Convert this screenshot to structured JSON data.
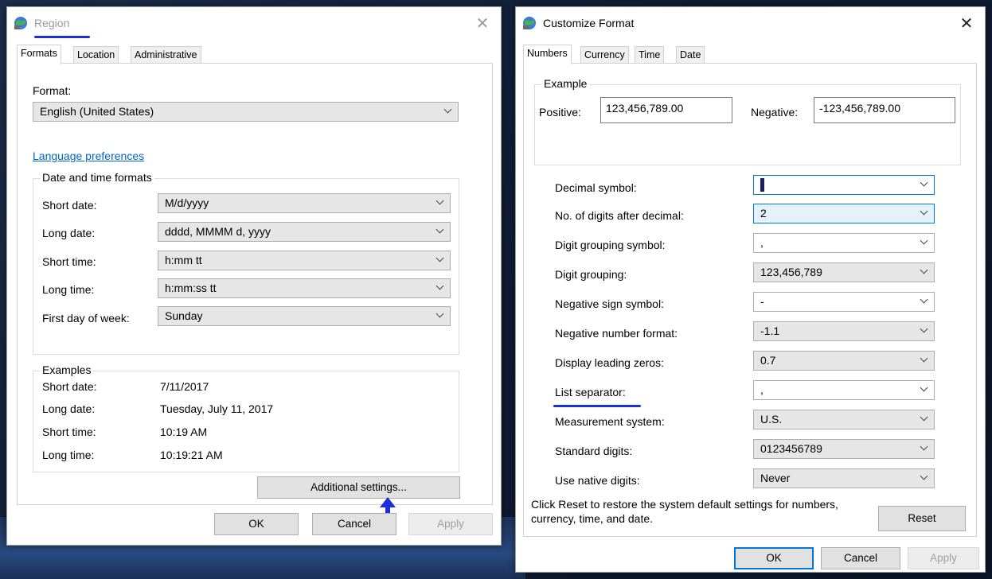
{
  "region": {
    "title": "Region",
    "close_glyph": "✕",
    "icon": "globe-icon",
    "tabs": [
      "Formats",
      "Location",
      "Administrative"
    ],
    "format_label": "Format:",
    "format_value": "English (United States)",
    "language_link": "Language preferences",
    "date_time_group": "Date and time formats",
    "fields": [
      {
        "label": "Short date:",
        "value": "M/d/yyyy"
      },
      {
        "label": "Long date:",
        "value": "dddd, MMMM d, yyyy"
      },
      {
        "label": "Short time:",
        "value": "h:mm tt"
      },
      {
        "label": "Long time:",
        "value": "h:mm:ss tt"
      },
      {
        "label": "First day of week:",
        "value": "Sunday"
      }
    ],
    "examples_group": "Examples",
    "examples": [
      {
        "label": "Short date:",
        "value": "7/11/2017"
      },
      {
        "label": "Long date:",
        "value": "Tuesday, July 11, 2017"
      },
      {
        "label": "Short time:",
        "value": "10:19 AM"
      },
      {
        "label": "Long time:",
        "value": "10:19:21 AM"
      }
    ],
    "additional_button": "Additional settings...",
    "ok": "OK",
    "cancel": "Cancel",
    "apply": "Apply"
  },
  "customize": {
    "title": "Customize Format",
    "close_glyph": "✕",
    "icon": "globe-icon",
    "tabs": [
      "Numbers",
      "Currency",
      "Time",
      "Date"
    ],
    "example_group": "Example",
    "positive_label": "Positive:",
    "positive_value": "123,456,789.00",
    "negative_label": "Negative:",
    "negative_value": "-123,456,789.00",
    "settings": [
      {
        "label": "Decimal symbol:",
        "value": "."
      },
      {
        "label": "No. of digits after decimal:",
        "value": "2"
      },
      {
        "label": "Digit grouping symbol:",
        "value": ","
      },
      {
        "label": "Digit grouping:",
        "value": "123,456,789"
      },
      {
        "label": "Negative sign symbol:",
        "value": "-"
      },
      {
        "label": "Negative number format:",
        "value": "-1.1"
      },
      {
        "label": "Display leading zeros:",
        "value": "0.7"
      },
      {
        "label": "List separator:",
        "value": ","
      },
      {
        "label": "Measurement system:",
        "value": "U.S."
      },
      {
        "label": "Standard digits:",
        "value": "0123456789"
      },
      {
        "label": "Use native digits:",
        "value": "Never"
      }
    ],
    "reset_text": "Click Reset to restore the system default settings for numbers, currency, time, and date.",
    "reset_button": "Reset",
    "ok": "OK",
    "cancel": "Cancel",
    "apply": "Apply"
  },
  "colors": {
    "accent": "#0078d7",
    "link": "#0066cc",
    "annotation": "#1d2fd6"
  }
}
